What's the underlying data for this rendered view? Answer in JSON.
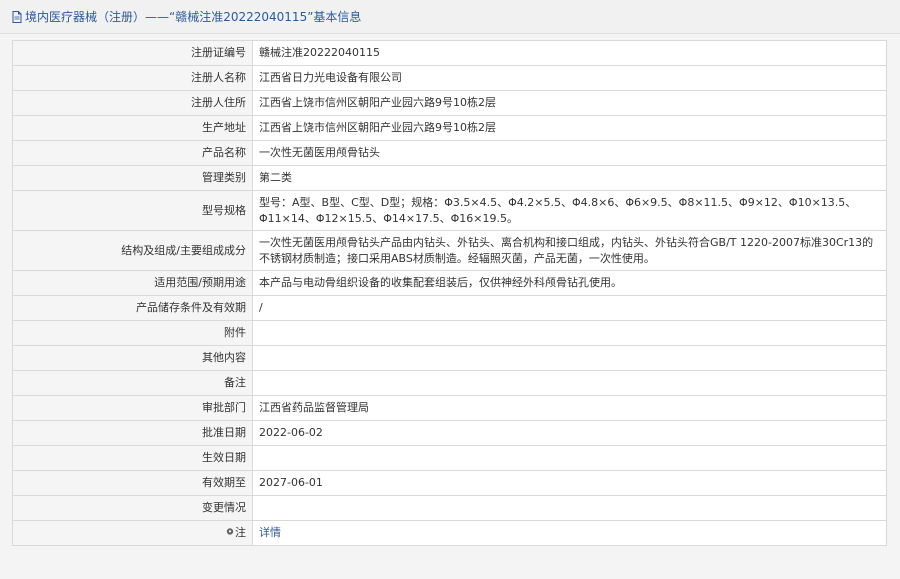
{
  "header": {
    "title": "境内医疗器械（注册）——“赣械注准20222040115”基本信息"
  },
  "rows": [
    {
      "key": "注册证编号",
      "value": "赣械注准20222040115"
    },
    {
      "key": "注册人名称",
      "value": "江西省日力光电设备有限公司"
    },
    {
      "key": "注册人住所",
      "value": "江西省上饶市信州区朝阳产业园六路9号10栋2层"
    },
    {
      "key": "生产地址",
      "value": "江西省上饶市信州区朝阳产业园六路9号10栋2层"
    },
    {
      "key": "产品名称",
      "value": "一次性无菌医用颅骨钻头"
    },
    {
      "key": "管理类别",
      "value": "第二类"
    },
    {
      "key": "型号规格",
      "value": "型号：A型、B型、C型、D型；规格：Φ3.5×4.5、Φ4.2×5.5、Φ4.8×6、Φ6×9.5、Φ8×11.5、Φ9×12、Φ10×13.5、Φ11×14、Φ12×15.5、Φ14×17.5、Φ16×19.5。"
    },
    {
      "key": "结构及组成/主要组成成分",
      "value": "一次性无菌医用颅骨钻头产品由内钻头、外钻头、离合机构和接口组成，内钻头、外钻头符合GB/T 1220-2007标准30Cr13的不锈钢材质制造；接口采用ABS材质制造。经辐照灭菌，产品无菌，一次性使用。"
    },
    {
      "key": "适用范围/预期用途",
      "value": "本产品与电动骨组织设备的收集配套组装后，仅供神经外科颅骨钻孔使用。"
    },
    {
      "key": "产品储存条件及有效期",
      "value": "/"
    },
    {
      "key": "附件",
      "value": ""
    },
    {
      "key": "其他内容",
      "value": ""
    },
    {
      "key": "备注",
      "value": ""
    },
    {
      "key": "审批部门",
      "value": "江西省药品监督管理局"
    },
    {
      "key": "批准日期",
      "value": "2022-06-02"
    },
    {
      "key": "生效日期",
      "value": ""
    },
    {
      "key": "有效期至",
      "value": "2027-06-01"
    },
    {
      "key": "变更情况",
      "value": ""
    }
  ],
  "note": {
    "key": "注",
    "link": "详情"
  },
  "icons": {
    "header": "document-icon",
    "note": "location-pin-icon"
  },
  "colors": {
    "link": "#2b5a9b",
    "key_bg": "#f5f5f5",
    "border": "#d9d9d9"
  }
}
